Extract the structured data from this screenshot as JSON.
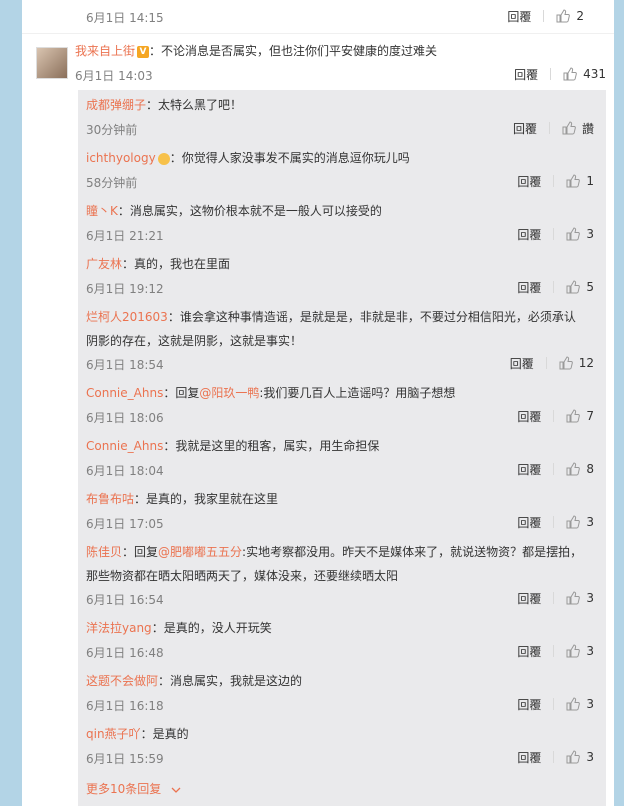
{
  "top_row": {
    "date": "6月1日 14:15",
    "reply": "回覆",
    "likes": "2"
  },
  "main_comment": {
    "user": "我来自上街",
    "text": "：不论消息是否属实，但也注你们平安健康的度过难关",
    "date": "6月1日 14:03",
    "reply": "回覆",
    "likes": "431"
  },
  "replies": [
    {
      "user": "成都弹绷子",
      "text": "：太特么黑了吧！",
      "date": "30分钟前",
      "reply": "回覆",
      "likes": "讚"
    },
    {
      "user": "ichthyology",
      "text": "：你觉得人家没事发不属实的消息逗你玩儿吗",
      "date": "58分钟前",
      "reply": "回覆",
      "likes": "1"
    },
    {
      "user": "瞳丶K",
      "text": "：消息属实，这物价根本就不是一般人可以接受的",
      "date": "6月1日 21:21",
      "reply": "回覆",
      "likes": "3"
    },
    {
      "user": "广友林",
      "text": "：真的，我也在里面",
      "date": "6月1日 19:12",
      "reply": "回覆",
      "likes": "5"
    },
    {
      "user": "烂柯人201603",
      "text": "：谁会拿这种事情造谣，是就是是，非就是非，不要过分相信阳光，必须承认",
      "text2": "阴影的存在，这就是阴影，这就是事实！",
      "date": "6月1日 18:54",
      "reply": "回覆",
      "likes": "12"
    },
    {
      "user": "Connie_Ahns",
      "pre": "：回复",
      "mention": "@阳玖一鸭",
      "text": ":我们要几百人上造谣吗？用脑子想想",
      "date": "6月1日 18:06",
      "reply": "回覆",
      "likes": "7"
    },
    {
      "user": "Connie_Ahns",
      "text": "：我就是这里的租客，属实，用生命担保",
      "date": "6月1日 18:04",
      "reply": "回覆",
      "likes": "8"
    },
    {
      "user": "布鲁布咕",
      "text": "：是真的，我家里就在这里",
      "date": "6月1日 17:05",
      "reply": "回覆",
      "likes": "3"
    },
    {
      "user": "陈佳贝",
      "pre": "：回复",
      "mention": "@肥嘟嘟五五分",
      "text": ":实地考察都没用。昨天不是媒体来了，就说送物资？都是摆拍，",
      "text2": "那些物资都在晒太阳晒两天了，媒体没来，还要继续晒太阳",
      "date": "6月1日 16:54",
      "reply": "回覆",
      "likes": "3"
    },
    {
      "user": "洋法拉yang",
      "text": "：是真的，没人开玩笑",
      "date": "6月1日 16:48",
      "reply": "回覆",
      "likes": "3"
    },
    {
      "user": "这题不会做阿",
      "text": "：消息属实，我就是这边的",
      "date": "6月1日 16:18",
      "reply": "回覆",
      "likes": "3"
    },
    {
      "user": "qin燕子吖",
      "text": "：是真的",
      "date": "6月1日 15:59",
      "reply": "回覆",
      "likes": "3"
    }
  ],
  "more_replies": "更多10条回复",
  "icons": {
    "like": "thumbs-up-icon",
    "verified": "verified-v-icon",
    "crown": "member-crown-icon",
    "more": "chevron-down-icon"
  },
  "colors": {
    "username": "#eb7350",
    "background": "#b3d4e6",
    "subpanel": "#eaeaec"
  }
}
